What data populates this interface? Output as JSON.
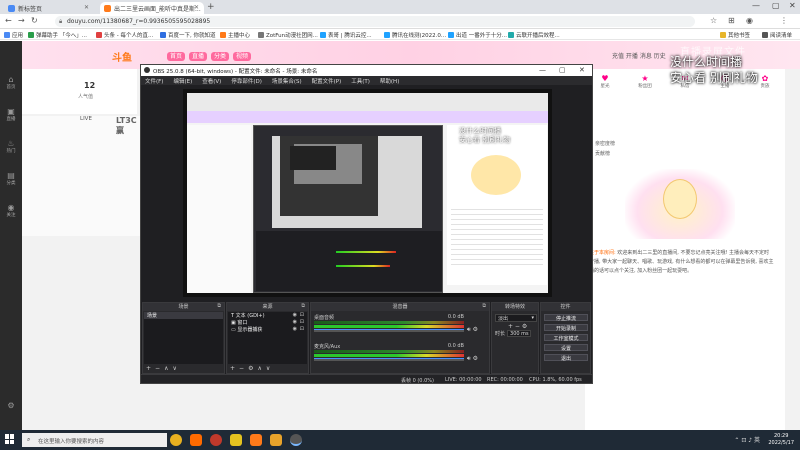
{
  "browser": {
    "tabs": [
      {
        "title": "新标签页",
        "color": "#4a8af4"
      },
      {
        "title": "出二三里云画面_能听中真是斯...",
        "color": "#ff7a1a"
      }
    ],
    "url": "douyu.com/11380687_r=0.9936505595028895",
    "bookmarks": [
      {
        "label": "应用",
        "color": "#4a8af4"
      },
      {
        "label": "弹幕助手 「今へ」...",
        "color": "#2a9d4a"
      },
      {
        "label": "头条 - 每个人的直...",
        "color": "#e04040"
      },
      {
        "label": "百度一下, 你就知道",
        "color": "#2f6ee0"
      },
      {
        "label": "主播中心",
        "color": "#ff7a1a"
      },
      {
        "label": "ZotFun动漫社团网...",
        "color": "#777"
      },
      {
        "label": "表哥 | 腾讯云控...",
        "color": "#1fa2ff"
      },
      {
        "label": "腾讯在线测(2022.0...",
        "color": "#1fa2ff"
      },
      {
        "label": "出道 一番外于十分...",
        "color": "#1fa2ff"
      },
      {
        "label": "云联开播后效程...",
        "color": "#2aa"
      },
      {
        "label": "其他书签",
        "color": "#e7b52b"
      },
      {
        "label": "阅读清单",
        "color": "#555"
      }
    ]
  },
  "douyu": {
    "logo": "斗鱼",
    "channels": [
      "首页",
      "直播",
      "分类",
      "视频"
    ],
    "header_right": "充值  开播  消息  历史",
    "left_nav": [
      {
        "icon": "⌂",
        "label": "首页"
      },
      {
        "icon": "▣",
        "label": "直播"
      },
      {
        "icon": "♨",
        "label": "热门"
      },
      {
        "icon": "▤",
        "label": "分类"
      },
      {
        "icon": "◉",
        "label": "关注"
      }
    ],
    "room_count": "12",
    "room_count_label": "人气值",
    "promo_text": "LIVE",
    "promo_big": "LT3C赢",
    "right_icons": [
      {
        "icon": "♥",
        "label": "星光"
      },
      {
        "icon": "★",
        "label": "粉丝团"
      },
      {
        "icon": "✉",
        "label": "私信"
      },
      {
        "icon": "☺",
        "label": "主播"
      },
      {
        "icon": "✿",
        "label": "贵族"
      }
    ],
    "right_list": [
      "亲密度榜",
      "贡献榜",
      "粉丝团",
      "新人榜"
    ],
    "desc_highlight": "关于本房间:",
    "desc_text": "欢迎来到出二三里的直播间, 不要忘记点亮关注哦! 主播会每天不定时开播, 带大家一起聊天、唱歌、玩游戏, 有什么想看的都可以在弹幕里告诉我, 喜欢主播的话可以点个关注, 加入粉丝团一起玩耍吧。",
    "overlay": [
      "没什么时间播",
      "安心看 别刷礼物"
    ],
    "watermark": "直播录屏文件",
    "timestamp": "2022/5/17"
  },
  "obs": {
    "title": "OBS 25.0.8 (64-bit, windows) - 配置文件: 未命名 - 场景: 未命名",
    "menu": [
      "文件(F)",
      "编辑(E)",
      "查看(V)",
      "停靠部件(D)",
      "场景集合(S)",
      "配置文件(P)",
      "工具(T)",
      "帮助(H)"
    ],
    "docks": {
      "scenes": {
        "title": "场景",
        "items": [
          "场景"
        ],
        "footer": [
          "+",
          "−",
          "∧",
          "∨"
        ]
      },
      "sources": {
        "title": "来源",
        "items": [
          {
            "icon": "T",
            "name": "文本 (GDI+)"
          },
          {
            "icon": "▣",
            "name": "窗口"
          },
          {
            "icon": "▭",
            "name": "显示器捕获"
          }
        ],
        "footer": [
          "+",
          "−",
          "⚙",
          "∧",
          "∨"
        ]
      },
      "mixer": {
        "title": "混音器",
        "channels": [
          {
            "name": "桌面音频",
            "db": "0.0 dB"
          },
          {
            "name": "麦克风/Aux",
            "db": "0.0 dB"
          }
        ]
      },
      "transitions": {
        "title": "转场特效",
        "type": "淡出",
        "duration_label": "时长",
        "duration": "300 ms"
      },
      "controls": {
        "title": "控件",
        "buttons": [
          "停止推流",
          "开始录制",
          "工作室模式",
          "设置",
          "退出"
        ]
      }
    },
    "status": {
      "fps_drop": "丢帧 0 (0.0%)",
      "live": "LIVE: 00:00:00",
      "rec": "REC: 00:00:00",
      "cpu": "CPU: 1.8%, 60.00 fps",
      "kbps": "kb/s: 2450"
    },
    "nested_overlay": [
      "没什么时间播",
      "安心看 别刷礼物"
    ]
  },
  "taskbar": {
    "search_placeholder": "在这里输入你要搜索的内容",
    "apps": [
      {
        "name": "chrome",
        "color": "#e8b020"
      },
      {
        "name": "douyu-live",
        "color": "#ff6a00"
      },
      {
        "name": "qq",
        "color": "#c0392b"
      },
      {
        "name": "yellow-app",
        "color": "#e5c320"
      },
      {
        "name": "orange-app",
        "color": "#ff7a1a"
      },
      {
        "name": "files",
        "color": "#e8a32b"
      },
      {
        "name": "obs",
        "color": "#555"
      }
    ],
    "tray": "⌃  ⊡  ♪  英",
    "time": "20:29",
    "date": "2022/5/17"
  }
}
